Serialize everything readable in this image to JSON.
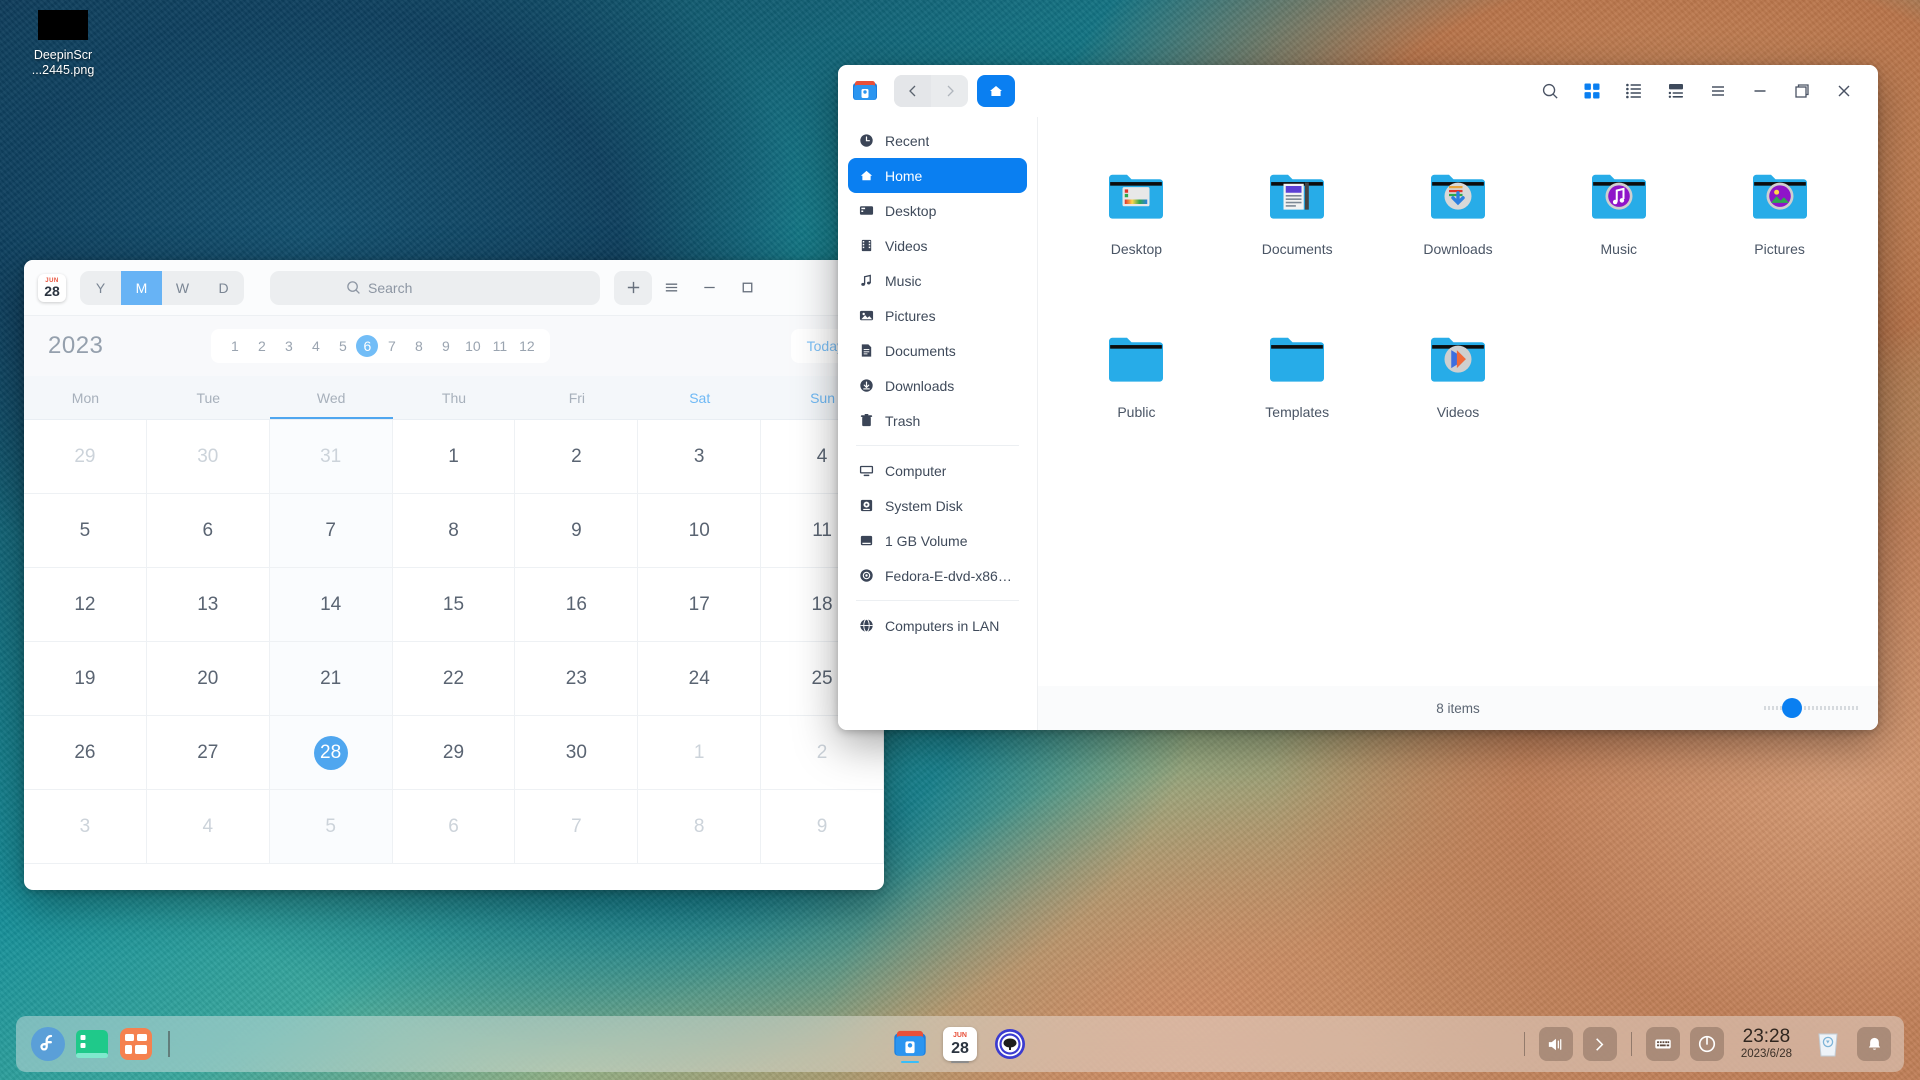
{
  "desktop": {
    "icon": {
      "name": "DeepinScr\n...2445.png",
      "line1": "DeepinScr",
      "line2": "...2445.png"
    }
  },
  "calendar_window": {
    "app_icon": {
      "month": "JUN",
      "day": "28"
    },
    "view_modes": [
      {
        "key": "Y",
        "label": "Y",
        "active": false
      },
      {
        "key": "M",
        "label": "M",
        "active": true
      },
      {
        "key": "W",
        "label": "W",
        "active": false
      },
      {
        "key": "D",
        "label": "D",
        "active": false
      }
    ],
    "search_placeholder": "Search",
    "add_label": "+",
    "year": "2023",
    "months": [
      "1",
      "2",
      "3",
      "4",
      "5",
      "6",
      "7",
      "8",
      "9",
      "10",
      "11",
      "12"
    ],
    "selected_month": "6",
    "today_label": "Today",
    "weekdays": [
      "Mon",
      "Tue",
      "Wed",
      "Thu",
      "Fri",
      "Sat",
      "Sun"
    ],
    "current_weekday": "Wed",
    "weekend_days": [
      "Sat",
      "Sun"
    ],
    "today_date": "28",
    "days": [
      {
        "d": "29",
        "out": true
      },
      {
        "d": "30",
        "out": true
      },
      {
        "d": "31",
        "out": true
      },
      {
        "d": "1",
        "out": false
      },
      {
        "d": "2",
        "out": false
      },
      {
        "d": "3",
        "out": false
      },
      {
        "d": "4",
        "out": false
      },
      {
        "d": "5",
        "out": false
      },
      {
        "d": "6",
        "out": false
      },
      {
        "d": "7",
        "out": false
      },
      {
        "d": "8",
        "out": false
      },
      {
        "d": "9",
        "out": false
      },
      {
        "d": "10",
        "out": false
      },
      {
        "d": "11",
        "out": false
      },
      {
        "d": "12",
        "out": false
      },
      {
        "d": "13",
        "out": false
      },
      {
        "d": "14",
        "out": false
      },
      {
        "d": "15",
        "out": false
      },
      {
        "d": "16",
        "out": false
      },
      {
        "d": "17",
        "out": false
      },
      {
        "d": "18",
        "out": false
      },
      {
        "d": "19",
        "out": false
      },
      {
        "d": "20",
        "out": false
      },
      {
        "d": "21",
        "out": false
      },
      {
        "d": "22",
        "out": false
      },
      {
        "d": "23",
        "out": false
      },
      {
        "d": "24",
        "out": false
      },
      {
        "d": "25",
        "out": false
      },
      {
        "d": "26",
        "out": false
      },
      {
        "d": "27",
        "out": false
      },
      {
        "d": "28",
        "out": false,
        "today": true
      },
      {
        "d": "29",
        "out": false
      },
      {
        "d": "30",
        "out": false
      },
      {
        "d": "1",
        "out": true
      },
      {
        "d": "2",
        "out": true
      },
      {
        "d": "3",
        "out": true
      },
      {
        "d": "4",
        "out": true
      },
      {
        "d": "5",
        "out": true
      },
      {
        "d": "6",
        "out": true
      },
      {
        "d": "7",
        "out": true
      },
      {
        "d": "8",
        "out": true
      },
      {
        "d": "9",
        "out": true
      }
    ]
  },
  "file_manager": {
    "nav": {
      "back": "‹",
      "forward": "›",
      "home": "home-icon"
    },
    "toolbar": [
      {
        "icon": "search-icon",
        "label": "Search",
        "active": false
      },
      {
        "icon": "icon-view-icon",
        "label": "Icon view",
        "active": true
      },
      {
        "icon": "list-view-icon",
        "label": "List view",
        "active": false
      },
      {
        "icon": "detail-view-icon",
        "label": "Extend view",
        "active": false
      },
      {
        "icon": "menu-icon",
        "label": "Menu",
        "active": false
      }
    ],
    "window_controls": [
      {
        "icon": "minimize-icon",
        "label": "Minimize"
      },
      {
        "icon": "maximize-icon",
        "label": "Maximize"
      },
      {
        "icon": "close-icon",
        "label": "Close"
      }
    ],
    "sidebar": {
      "groups": [
        {
          "items": [
            {
              "label": "Recent",
              "icon": "clock-icon",
              "active": false
            },
            {
              "label": "Home",
              "icon": "home-icon",
              "active": true
            },
            {
              "label": "Desktop",
              "icon": "desktop-icon",
              "active": false
            },
            {
              "label": "Videos",
              "icon": "video-icon",
              "active": false
            },
            {
              "label": "Music",
              "icon": "music-icon",
              "active": false
            },
            {
              "label": "Pictures",
              "icon": "pictures-icon",
              "active": false
            },
            {
              "label": "Documents",
              "icon": "documents-icon",
              "active": false
            },
            {
              "label": "Downloads",
              "icon": "downloads-icon",
              "active": false
            },
            {
              "label": "Trash",
              "icon": "trash-icon",
              "active": false
            }
          ]
        },
        {
          "items": [
            {
              "label": "Computer",
              "icon": "computer-icon",
              "active": false
            },
            {
              "label": "System Disk",
              "icon": "disk-icon",
              "active": false
            },
            {
              "label": "1 GB Volume",
              "icon": "volume-icon",
              "active": false
            },
            {
              "label": "Fedora-E-dvd-x86_...",
              "icon": "disc-icon",
              "active": false
            }
          ]
        },
        {
          "items": [
            {
              "label": "Computers in LAN",
              "icon": "network-icon",
              "active": false
            }
          ]
        }
      ]
    },
    "files": [
      {
        "name": "Desktop",
        "emblem": "desktop"
      },
      {
        "name": "Documents",
        "emblem": "documents"
      },
      {
        "name": "Downloads",
        "emblem": "downloads"
      },
      {
        "name": "Music",
        "emblem": "music"
      },
      {
        "name": "Pictures",
        "emblem": "pictures"
      },
      {
        "name": "Public",
        "emblem": "none"
      },
      {
        "name": "Templates",
        "emblem": "none"
      },
      {
        "name": "Videos",
        "emblem": "videos"
      }
    ],
    "status": {
      "item_count": "8 items",
      "zoom_value": "20"
    }
  },
  "dock": {
    "left_apps": [
      {
        "name": "fedora-launcher",
        "label": "Fedora"
      },
      {
        "name": "terminal",
        "label": "Terminal"
      },
      {
        "name": "app-store",
        "label": "App Store"
      }
    ],
    "center_apps": [
      {
        "name": "file-manager",
        "label": "File Manager",
        "running": true
      },
      {
        "name": "calendar",
        "label": "Calendar",
        "running": true,
        "month": "JUN",
        "day": "28"
      },
      {
        "name": "settings",
        "label": "Control Center",
        "running": false
      }
    ],
    "tray": [
      {
        "name": "volume-icon",
        "label": "Volume"
      },
      {
        "name": "expand-tray-icon",
        "label": "Show more"
      },
      {
        "name": "keyboard-icon",
        "label": "Keyboard layout"
      },
      {
        "name": "power-icon",
        "label": "Power"
      }
    ],
    "clock": {
      "time": "23:28",
      "date": "2023/6/28"
    },
    "right_icons": [
      {
        "name": "trash-icon",
        "label": "Trash"
      },
      {
        "name": "notification-icon",
        "label": "Notifications"
      }
    ]
  },
  "colors": {
    "accent_blue": "#0a7ff1",
    "calendar_blue": "#4fa6ef",
    "folder_blue": "#27ace8"
  }
}
